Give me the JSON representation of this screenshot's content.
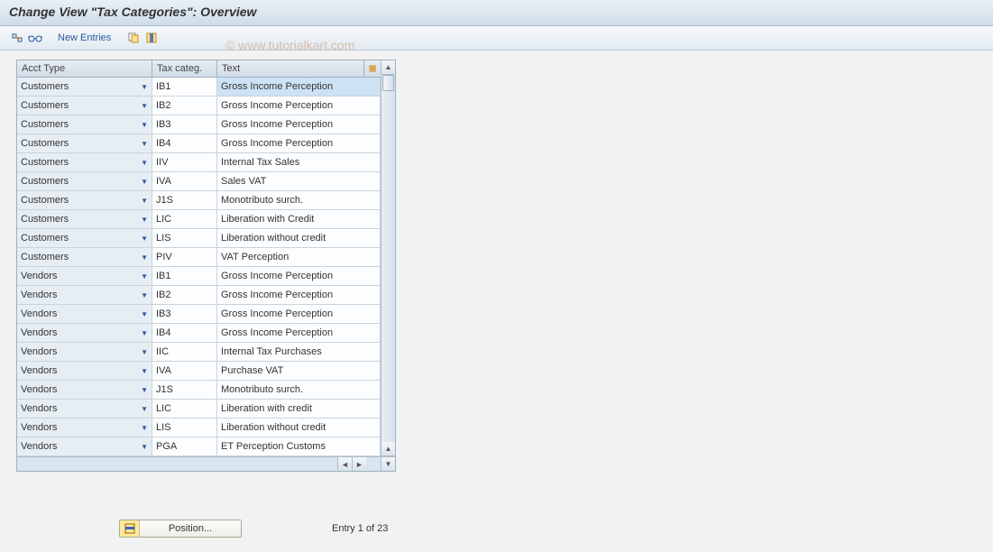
{
  "title": "Change View \"Tax Categories\": Overview",
  "toolbar": {
    "new_entries": "New Entries"
  },
  "watermark": "© www.tutorialkart.com",
  "grid": {
    "headers": {
      "acct": "Acct Type",
      "tax": "Tax categ.",
      "text": "Text"
    },
    "rows": [
      {
        "acct": "Customers",
        "tax": "IB1",
        "text": "Gross Income Perception",
        "selected": true
      },
      {
        "acct": "Customers",
        "tax": "IB2",
        "text": "Gross Income Perception"
      },
      {
        "acct": "Customers",
        "tax": "IB3",
        "text": "Gross Income Perception"
      },
      {
        "acct": "Customers",
        "tax": "IB4",
        "text": "Gross Income Perception"
      },
      {
        "acct": "Customers",
        "tax": "IIV",
        "text": "Internal Tax Sales"
      },
      {
        "acct": "Customers",
        "tax": "IVA",
        "text": "Sales VAT"
      },
      {
        "acct": "Customers",
        "tax": "J1S",
        "text": "Monotributo surch."
      },
      {
        "acct": "Customers",
        "tax": "LIC",
        "text": "Liberation with Credit"
      },
      {
        "acct": "Customers",
        "tax": "LIS",
        "text": "Liberation without credit"
      },
      {
        "acct": "Customers",
        "tax": "PIV",
        "text": "VAT Perception"
      },
      {
        "acct": "Vendors",
        "tax": "IB1",
        "text": "Gross Income Perception"
      },
      {
        "acct": "Vendors",
        "tax": "IB2",
        "text": "Gross Income Perception"
      },
      {
        "acct": "Vendors",
        "tax": "IB3",
        "text": "Gross Income Perception"
      },
      {
        "acct": "Vendors",
        "tax": "IB4",
        "text": "Gross Income Perception"
      },
      {
        "acct": "Vendors",
        "tax": "IIC",
        "text": "Internal Tax Purchases"
      },
      {
        "acct": "Vendors",
        "tax": "IVA",
        "text": "Purchase VAT"
      },
      {
        "acct": "Vendors",
        "tax": "J1S",
        "text": "Monotributo surch."
      },
      {
        "acct": "Vendors",
        "tax": "LIC",
        "text": "Liberation with credit"
      },
      {
        "acct": "Vendors",
        "tax": "LIS",
        "text": "Liberation without credit"
      },
      {
        "acct": "Vendors",
        "tax": "PGA",
        "text": "ET Perception Customs"
      }
    ]
  },
  "footer": {
    "position_label": "Position...",
    "entry_text": "Entry 1 of 23"
  }
}
